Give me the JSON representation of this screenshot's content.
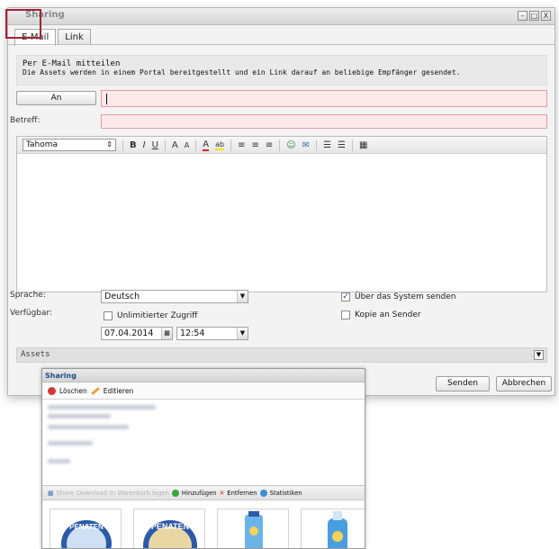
{
  "dialog": {
    "title": "Sharing",
    "window_buttons": [
      "–",
      "□",
      "X"
    ],
    "tabs": [
      {
        "label": "E-Mail",
        "active": true
      },
      {
        "label": "Link",
        "active": false
      }
    ],
    "info": {
      "heading": "Per E-Mail mitteilen",
      "text": "Die Assets werden in einem Portal bereitgestellt und ein Link darauf an beliebige Empfänger gesendet."
    },
    "to_button": "An",
    "to_value": "",
    "subject_label": "Betreff:",
    "subject_value": "",
    "editor": {
      "font": "Tahoma",
      "toolbar": [
        "B",
        "I",
        "U",
        "A",
        "A",
        "A",
        "ab",
        "≡",
        "≡",
        "≡",
        "☺",
        "✉",
        "☰",
        "☰",
        "▦"
      ]
    },
    "language_label": "Sprache:",
    "language_value": "Deutsch",
    "availability_label": "Verfügbar:",
    "unlimited_access_label": "Unlimitierter Zugriff",
    "unlimited_access_checked": false,
    "date_value": "07.04.2014",
    "time_value": "12:54",
    "send_via_system_label": "Über das System senden",
    "send_via_system_checked": true,
    "copy_to_sender_label": "Kopie an Sender",
    "copy_to_sender_checked": false,
    "assets_label": "Assets",
    "send_button": "Senden",
    "cancel_button": "Abbrechen"
  },
  "sharing_panel": {
    "title": "Sharing",
    "delete_label": "Löschen",
    "edit_label": "Editieren",
    "toolbar": {
      "share": "Share",
      "download": "Download",
      "watermark": "In Warenkorb legen",
      "add": "Hinzufügen",
      "remove": "Entfernen",
      "stats": "Statistiken"
    },
    "thumbnails": [
      "PENATEN",
      "PENATEN",
      "",
      ""
    ]
  },
  "colors": {
    "highlight": "#a12236",
    "error_fill": "#fde8ea",
    "error_border": "#e59aa4",
    "penaten_blue": "#2b5aa8"
  }
}
